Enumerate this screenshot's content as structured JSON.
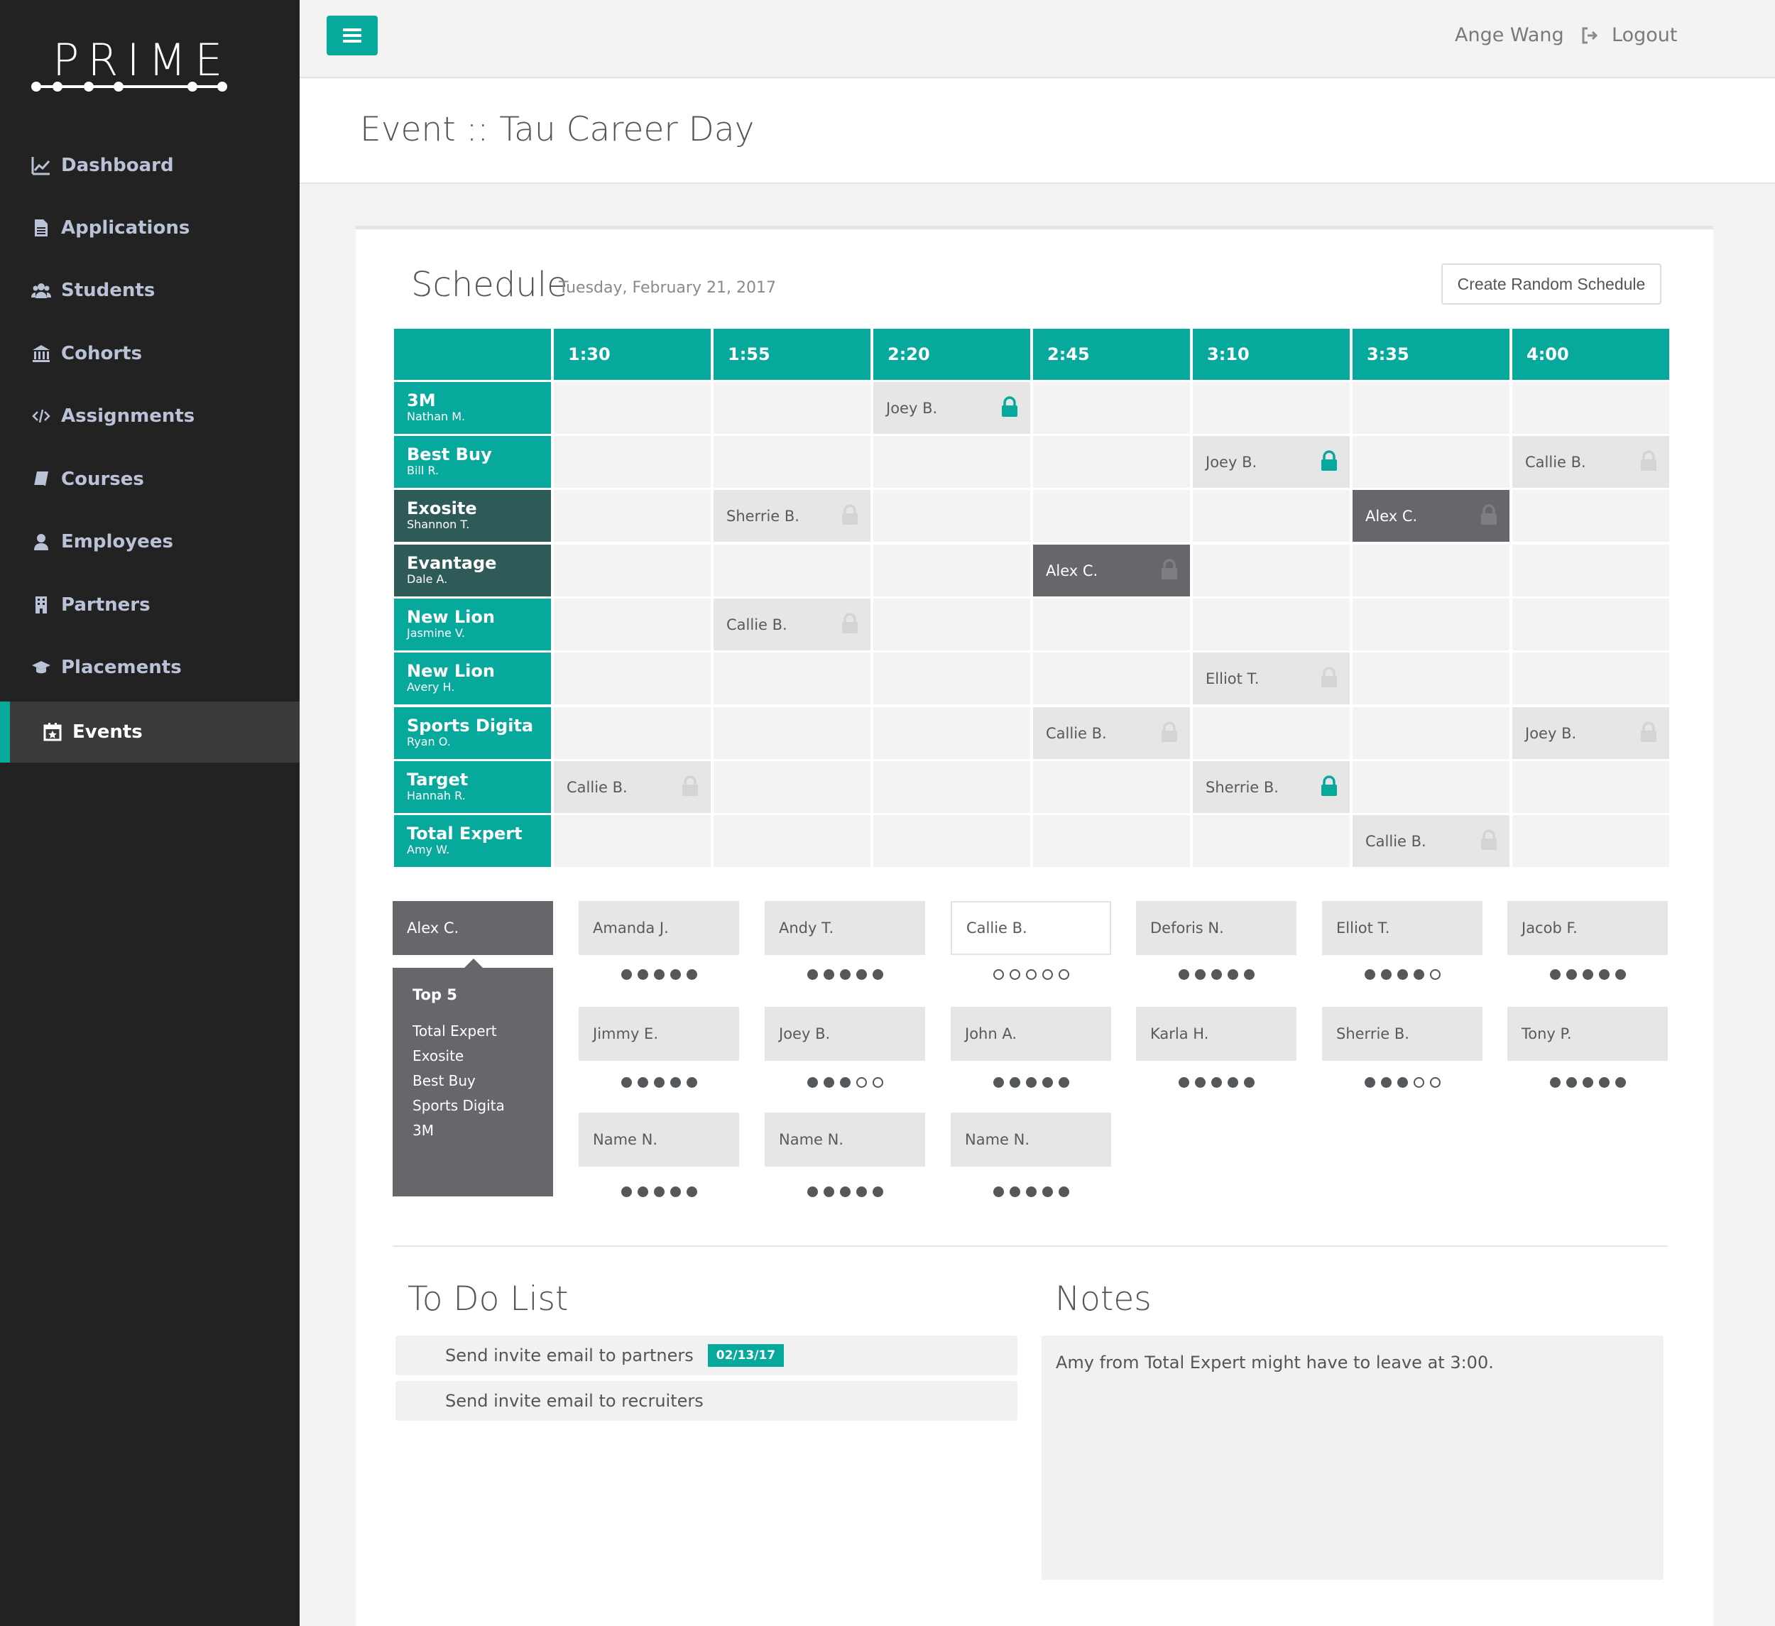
{
  "brand": {
    "logo_text": "PRIME"
  },
  "sidebar": {
    "items": [
      {
        "label": "Dashboard",
        "icon": "chart-line-icon"
      },
      {
        "label": "Applications",
        "icon": "file-icon"
      },
      {
        "label": "Students",
        "icon": "users-icon"
      },
      {
        "label": "Cohorts",
        "icon": "institution-icon"
      },
      {
        "label": "Assignments",
        "icon": "code-icon"
      },
      {
        "label": "Courses",
        "icon": "book-icon"
      },
      {
        "label": "Employees",
        "icon": "user-icon"
      },
      {
        "label": "Partners",
        "icon": "building-icon"
      },
      {
        "label": "Placements",
        "icon": "graduation-cap-icon"
      },
      {
        "label": "Events",
        "icon": "calendar-icon",
        "active": true
      }
    ]
  },
  "topbar": {
    "user_name": "Ange Wang",
    "logout_label": "Logout"
  },
  "header": {
    "title": "Event :: Tau Career Day"
  },
  "schedule": {
    "title": "Schedule",
    "date": "Tuesday, February 21, 2017",
    "random_button": "Create Random Schedule",
    "times": [
      "1:30",
      "1:55",
      "2:20",
      "2:45",
      "3:10",
      "3:35",
      "4:00"
    ],
    "rows": [
      {
        "company": "3M",
        "person": "Nathan M.",
        "style": "teal"
      },
      {
        "company": "Best Buy",
        "person": "Bill R.",
        "style": "teal"
      },
      {
        "company": "Exosite",
        "person": "Shannon T.",
        "style": "dark"
      },
      {
        "company": "Evantage",
        "person": "Dale A.",
        "style": "dark"
      },
      {
        "company": "New Lion",
        "person": "Jasmine V.",
        "style": "teal"
      },
      {
        "company": "New Lion",
        "person": "Avery H.",
        "style": "teal"
      },
      {
        "company": "Sports Digita",
        "person": "Ryan O.",
        "style": "teal"
      },
      {
        "company": "Target",
        "person": "Hannah R.",
        "style": "teal"
      },
      {
        "company": "Total Expert",
        "person": "Amy W.",
        "style": "teal"
      }
    ],
    "assignments": [
      {
        "row": 0,
        "col": 2,
        "name": "Joey B.",
        "locked": true,
        "dark": false
      },
      {
        "row": 1,
        "col": 4,
        "name": "Joey B.",
        "locked": true,
        "dark": false
      },
      {
        "row": 1,
        "col": 6,
        "name": "Callie B.",
        "locked": false,
        "dark": false
      },
      {
        "row": 2,
        "col": 1,
        "name": "Sherrie B.",
        "locked": false,
        "dark": false
      },
      {
        "row": 2,
        "col": 5,
        "name": "Alex C.",
        "locked": false,
        "dark": true
      },
      {
        "row": 3,
        "col": 3,
        "name": "Alex C.",
        "locked": false,
        "dark": true
      },
      {
        "row": 4,
        "col": 1,
        "name": "Callie B.",
        "locked": false,
        "dark": false
      },
      {
        "row": 5,
        "col": 4,
        "name": "Elliot T.",
        "locked": false,
        "dark": false
      },
      {
        "row": 6,
        "col": 3,
        "name": "Callie B.",
        "locked": false,
        "dark": false
      },
      {
        "row": 6,
        "col": 6,
        "name": "Joey B.",
        "locked": false,
        "dark": false
      },
      {
        "row": 7,
        "col": 0,
        "name": "Callie B.",
        "locked": false,
        "dark": false
      },
      {
        "row": 7,
        "col": 4,
        "name": "Sherrie B.",
        "locked": true,
        "dark": false
      },
      {
        "row": 8,
        "col": 5,
        "name": "Callie B.",
        "locked": false,
        "dark": false
      }
    ],
    "colors": {
      "teal": "#07a99d",
      "dark_teal": "#2e5b57",
      "slot_dark": "#65676a",
      "lock_inactive": "#d4d4d6"
    }
  },
  "students": {
    "selected": "Alex C.",
    "top5_title": "Top 5",
    "top5": [
      "Total Expert",
      "Exosite",
      "Best Buy",
      "Sports Digita",
      "3M"
    ],
    "pool": [
      {
        "name": "Amanda J.",
        "filled": 5
      },
      {
        "name": "Andy T.",
        "filled": 5
      },
      {
        "name": "Callie B.",
        "filled": 0,
        "outlined": true
      },
      {
        "name": "Deforis N.",
        "filled": 5
      },
      {
        "name": "Elliot T.",
        "filled": 4
      },
      {
        "name": "Jacob F.",
        "filled": 5
      },
      {
        "name": "Jimmy E.",
        "filled": 5
      },
      {
        "name": "Joey B.",
        "filled": 3
      },
      {
        "name": "John A.",
        "filled": 5
      },
      {
        "name": "Karla H.",
        "filled": 5
      },
      {
        "name": "Sherrie B.",
        "filled": 3
      },
      {
        "name": "Tony P.",
        "filled": 5
      },
      {
        "name": "Name N.",
        "filled": 5
      },
      {
        "name": "Name N.",
        "filled": 5
      },
      {
        "name": "Name N.",
        "filled": 5
      }
    ]
  },
  "todo": {
    "title": "To Do List",
    "items": [
      {
        "text": "Send invite email to partners",
        "badge": "02/13/17"
      },
      {
        "text": "Send invite email to recruiters",
        "badge": ""
      }
    ]
  },
  "notes": {
    "title": "Notes",
    "text": "Amy from Total Expert might have to leave at 3:00."
  }
}
